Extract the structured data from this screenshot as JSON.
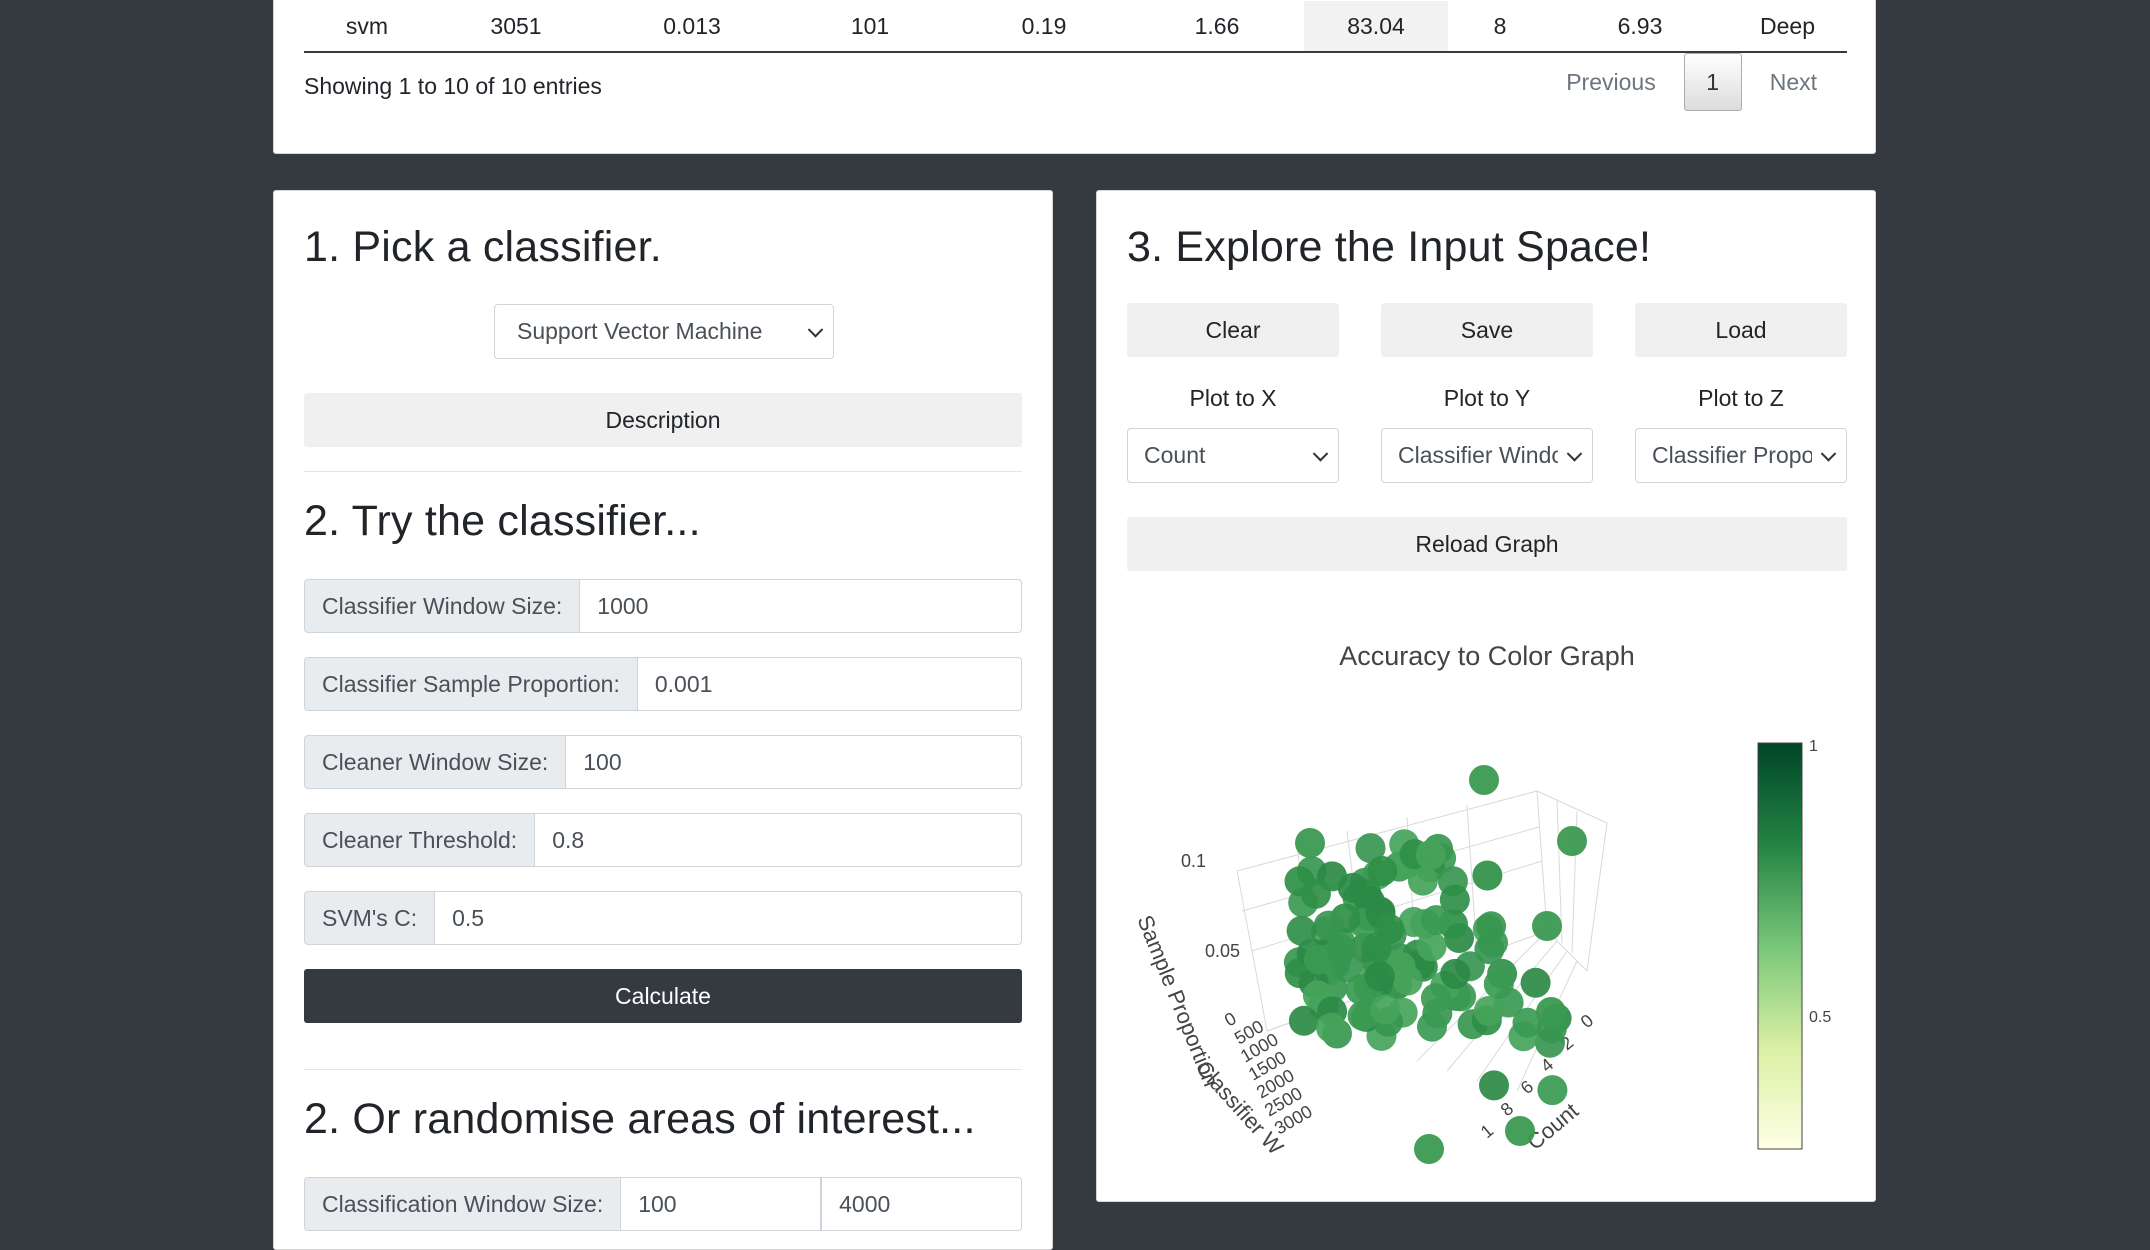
{
  "table": {
    "row": [
      "svm",
      "3051",
      "0.013",
      "101",
      "0.19",
      "1.66",
      "83.04",
      "8",
      "6.93",
      "Deep"
    ],
    "info": "Showing 1 to 10 of 10 entries",
    "previous": "Previous",
    "page": "1",
    "next": "Next"
  },
  "left": {
    "step1_title": "1. Pick a classifier.",
    "classifier_selected": "Support Vector Machine",
    "description_label": "Description",
    "step2_title": "2. Try the classifier...",
    "fields": [
      {
        "label": "Classifier Window Size:",
        "value": "1000"
      },
      {
        "label": "Classifier Sample Proportion:",
        "value": "0.001"
      },
      {
        "label": "Cleaner Window Size:",
        "value": "100"
      },
      {
        "label": "Cleaner Threshold:",
        "value": "0.8"
      },
      {
        "label": "SVM's C:",
        "value": "0.5"
      }
    ],
    "calculate_label": "Calculate",
    "step2b_title": "2. Or randomise areas of interest...",
    "range_field": {
      "label": "Classification Window Size:",
      "min": "100",
      "max": "4000"
    }
  },
  "right": {
    "step3_title": "3. Explore the Input Space!",
    "clear_label": "Clear",
    "save_label": "Save",
    "load_label": "Load",
    "plot_x_label": "Plot to X",
    "plot_y_label": "Plot to Y",
    "plot_z_label": "Plot to Z",
    "plot_x_value": "Count",
    "plot_y_value": "Classifier Window Size",
    "plot_z_value": "Classifier Proportion",
    "reload_label": "Reload Graph",
    "graph_title": "Accuracy to Color Graph"
  },
  "chart_data": {
    "type": "scatter",
    "title": "Accuracy to Color Graph",
    "axes": {
      "z_label": "Sample Proportion",
      "z_ticks": [
        "0.1",
        "0.05"
      ],
      "y_label": "Classifier W",
      "y_ticks": [
        "0",
        "500",
        "1000",
        "1500",
        "2000",
        "2500",
        "3000"
      ],
      "x_label": "Count",
      "x_ticks": [
        "0",
        "2",
        "4",
        "6",
        "8",
        "1"
      ]
    },
    "colorbar": {
      "min_tick": "0.5",
      "max_tick": "1",
      "colors": [
        "#ffffe5",
        "#d9f0a3",
        "#78c679",
        "#238443",
        "#004529"
      ]
    },
    "marker_color": "#3a9a50"
  }
}
